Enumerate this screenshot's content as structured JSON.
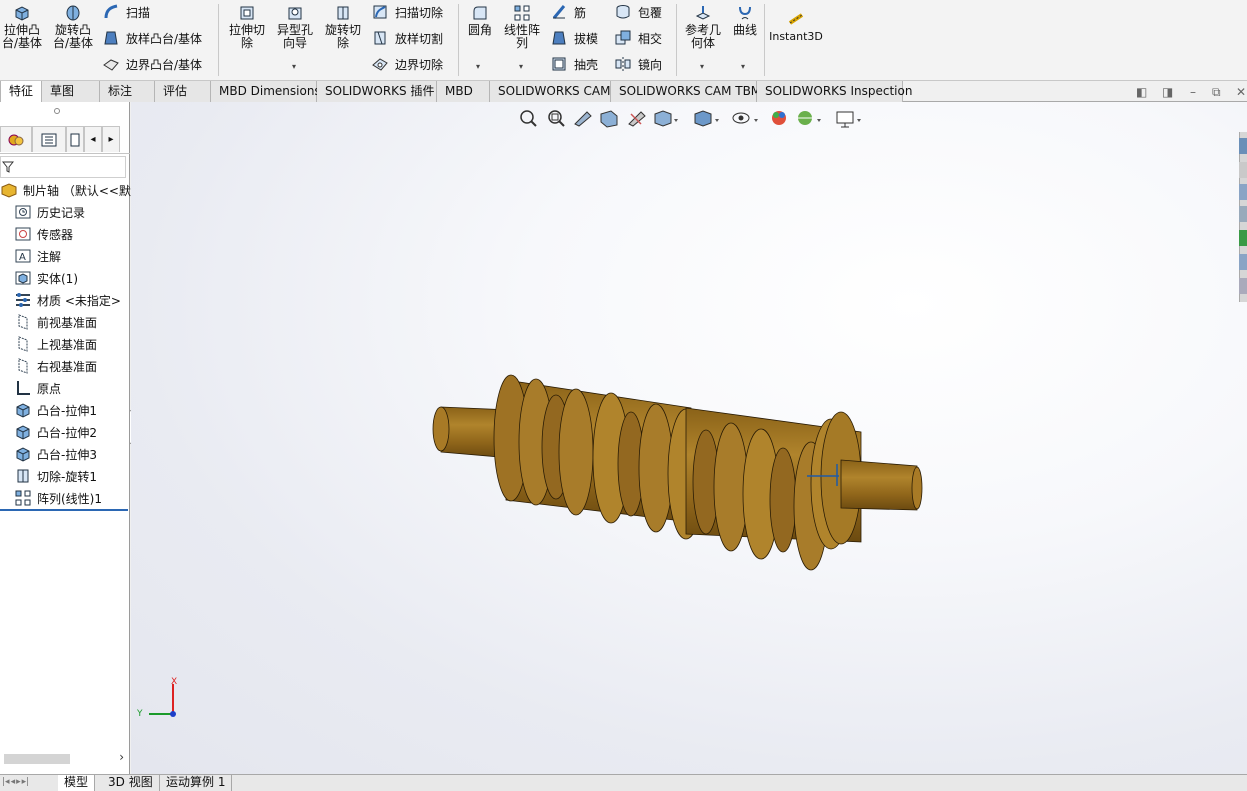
{
  "ribbon": {
    "extrude_boss": "拉伸凸\n台/基体",
    "revolve_boss": "旋转凸\n台/基体",
    "sweep": "扫描",
    "loft_boss": "放样凸台/基体",
    "boundary_boss": "边界凸台/基体",
    "extrude_cut": "拉伸切\n除",
    "hole_wizard": "异型孔\n向导",
    "revolve_cut": "旋转切\n除",
    "sweep_cut": "扫描切除",
    "loft_cut": "放样切割",
    "boundary_cut": "边界切除",
    "fillet": "圆角",
    "linear_pattern": "线性阵\n列",
    "rib": "筋",
    "draft": "拔模",
    "shell": "抽壳",
    "wrap": "包覆",
    "intersect": "相交",
    "mirror": "镜向",
    "reference_geometry": "参考几\n何体",
    "curves": "曲线",
    "instant3d": "Instant3D"
  },
  "tabs": [
    "特征",
    "草图",
    "标注",
    "评估",
    "MBD Dimensions",
    "SOLIDWORKS 插件",
    "MBD",
    "SOLIDWORKS CAM",
    "SOLIDWORKS CAM TBM",
    "SOLIDWORKS Inspection"
  ],
  "feature_tree": {
    "root": "制片轴 （默认<<默认",
    "items": [
      {
        "label": "历史记录",
        "icon": "history-icon"
      },
      {
        "label": "传感器",
        "icon": "sensor-icon"
      },
      {
        "label": "注解",
        "icon": "annotation-icon"
      },
      {
        "label": "实体(1)",
        "icon": "solid-bodies-icon"
      },
      {
        "label": "材质 <未指定>",
        "icon": "material-icon"
      },
      {
        "label": "前视基准面",
        "icon": "plane-icon"
      },
      {
        "label": "上视基准面",
        "icon": "plane-icon"
      },
      {
        "label": "右视基准面",
        "icon": "plane-icon"
      },
      {
        "label": "原点",
        "icon": "origin-icon"
      },
      {
        "label": "凸台-拉伸1",
        "icon": "extrude-feature-icon"
      },
      {
        "label": "凸台-拉伸2",
        "icon": "extrude-feature-icon"
      },
      {
        "label": "凸台-拉伸3",
        "icon": "extrude-feature-icon"
      },
      {
        "label": "切除-旋转1",
        "icon": "revolve-cut-feature-icon"
      },
      {
        "label": "阵列(线性)1",
        "icon": "linear-pattern-feature-icon"
      }
    ]
  },
  "triad": {
    "y": "Y",
    "x": "X"
  },
  "bottom_tabs": [
    "模型",
    "3D 视图",
    "运动算例 1"
  ],
  "colors": {
    "part": "#9a6e1e",
    "part_light": "#b8892e",
    "accent_blue": "#1f5aa6"
  }
}
